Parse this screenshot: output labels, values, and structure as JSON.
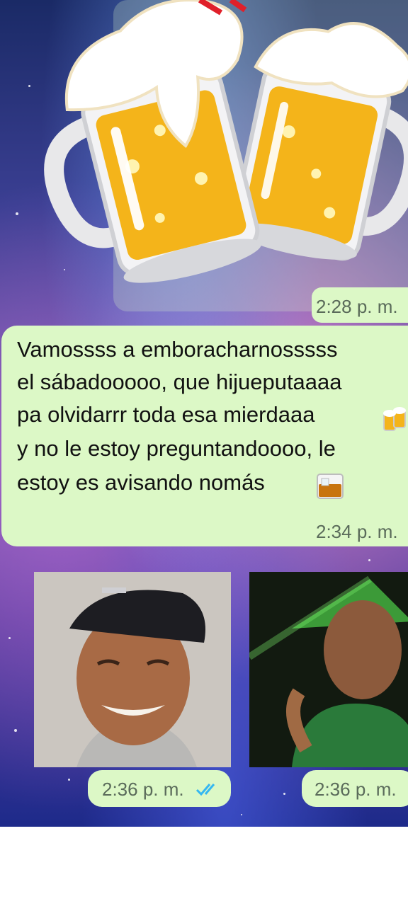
{
  "sticker": {
    "icon": "beer-mugs-cheers-sticker"
  },
  "messages": [
    {
      "id": "sticker-msg",
      "time": "2:28 p. m."
    },
    {
      "id": "text-msg",
      "lines": [
        "Vamossss a emboracharnosssss",
        "el sábadooooo, que hijueputaaaa",
        "pa olvidarrr toda esa mierdaaa",
        "y no le estoy preguntandoooo, le",
        "estoy es avisando nomás"
      ],
      "inline_emojis": [
        "beer-mugs-icon",
        "whisky-glass-icon"
      ],
      "time": "2:34 p. m."
    }
  ],
  "photos": [
    {
      "id": "photo-smiling-man-cap",
      "time": "2:36 p. m.",
      "read_receipt": "double-check-icon",
      "read_color": "#34b7f1"
    },
    {
      "id": "photo-man-green-light",
      "time": "2:36 p. m."
    }
  ],
  "colors": {
    "bubble": "#dcf8c6",
    "read_check": "#34b7f1"
  }
}
